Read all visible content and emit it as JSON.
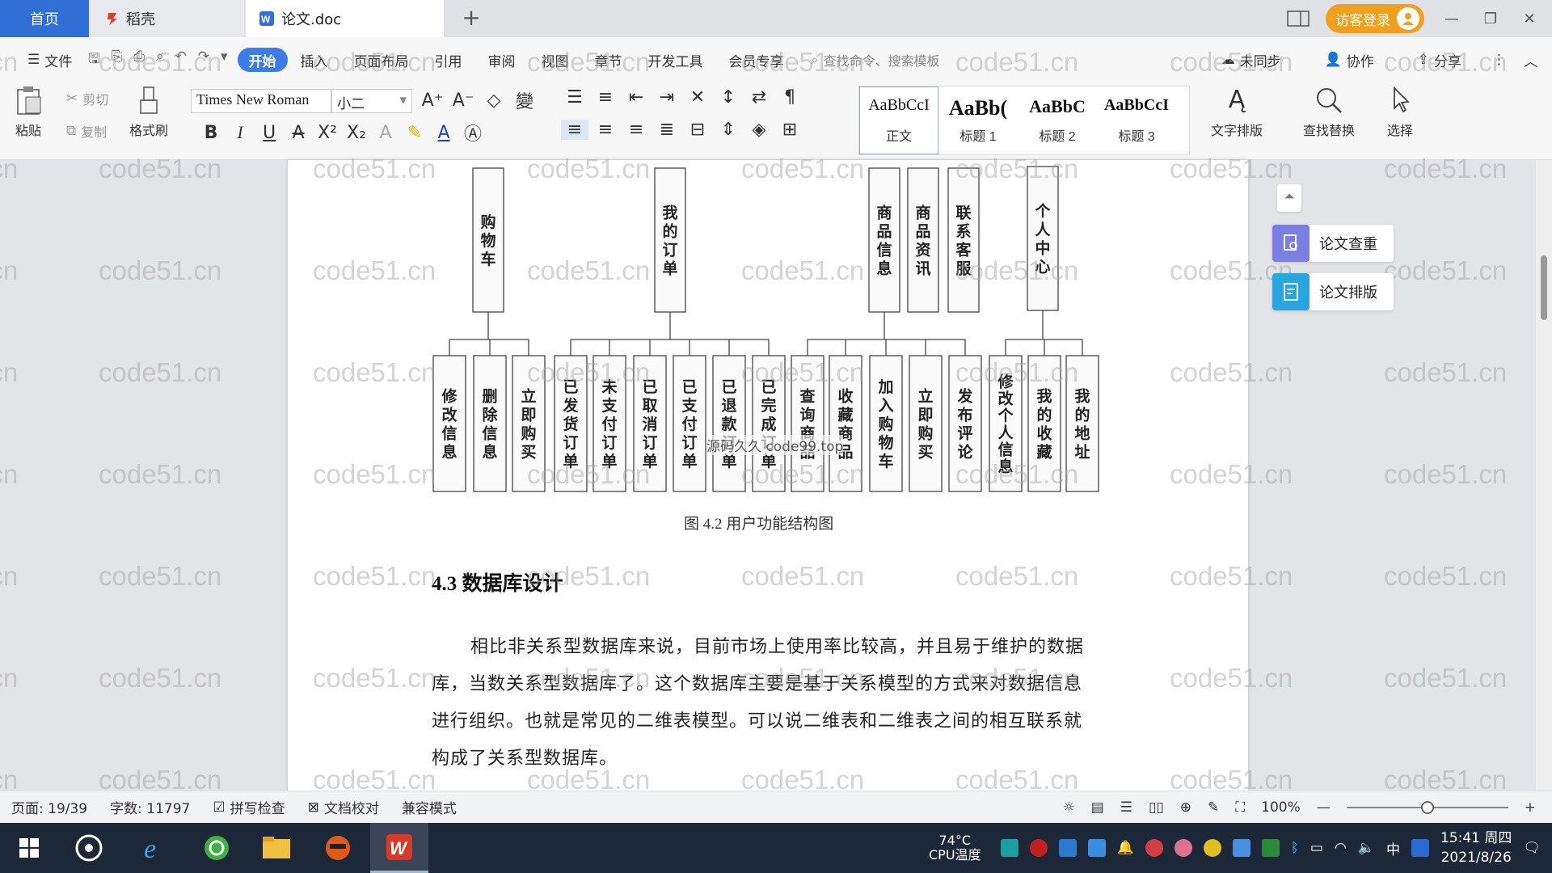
{
  "tabs": {
    "home": "首页",
    "daoke": "稻壳",
    "doc": "论文.doc"
  },
  "title_right": {
    "login": "访客登录"
  },
  "menu": {
    "file": "文件",
    "items": [
      "开始",
      "插入",
      "页面布局",
      "引用",
      "审阅",
      "视图",
      "章节",
      "开发工具",
      "会员专享"
    ],
    "search": "查找命令、搜索模板",
    "sync": "未同步",
    "collab": "协作",
    "share": "分享"
  },
  "ribbon": {
    "paste": "粘贴",
    "cut": "剪切",
    "copy": "复制",
    "format_painter": "格式刷",
    "font_name": "Times New Roman",
    "font_size": "小二",
    "styles": [
      {
        "preview": "AaBbCcI",
        "name": "正文"
      },
      {
        "preview": "AaBb(",
        "name": "标题 1"
      },
      {
        "preview": "AaBbC",
        "name": "标题 2"
      },
      {
        "preview": "AaBbCcI",
        "name": "标题 3"
      }
    ],
    "text_layout": "文字排版",
    "find_replace": "查找替换",
    "select": "选择"
  },
  "side_panel": {
    "check": "论文查重",
    "layout": "论文排版"
  },
  "diagram": {
    "top_nodes": [
      "购物车",
      "我的订单",
      "商品信息",
      "商品资讯",
      "联系客服",
      "个人中心"
    ],
    "leaf_nodes": [
      "修改信息",
      "删除信息",
      "立即购买",
      "已发货订单",
      "未支付订单",
      "已取消订单",
      "已支付订单",
      "已退款订单",
      "已完成订单",
      "查询商品",
      "收藏商品",
      "加入购物车",
      "立即购买",
      "发布评论",
      "修改个人信息",
      "我的收藏",
      "我的地址"
    ]
  },
  "watermark_center": "源码久久 code99.top",
  "watermark": "code51.cn",
  "document": {
    "caption": "图 4.2  用户功能结构图",
    "heading": "4.3 数据库设计",
    "paragraph_lines": [
      "相比非关系型数据库来说，目前市场上使用率比较高，并且易于维护的数据",
      "库，当数关系型数据库了。这个数据库主要是基于关系模型的方式来对数据信息",
      "进行组织。也就是常见的二维表模型。可以说二维表和二维表之间的相互联系就",
      "构成了关系型数据库。"
    ]
  },
  "status": {
    "page": "页面: 19/39",
    "words": "字数: 11797",
    "spell": "拼写检查",
    "proof": "文档校对",
    "compat": "兼容模式",
    "zoom": "100%",
    "zoom_level": 0.5
  },
  "taskbar": {
    "temp_value": "74°C",
    "temp_label": "CPU温度",
    "time": "15:41 周四",
    "date": "2021/8/26",
    "ime": "中"
  }
}
